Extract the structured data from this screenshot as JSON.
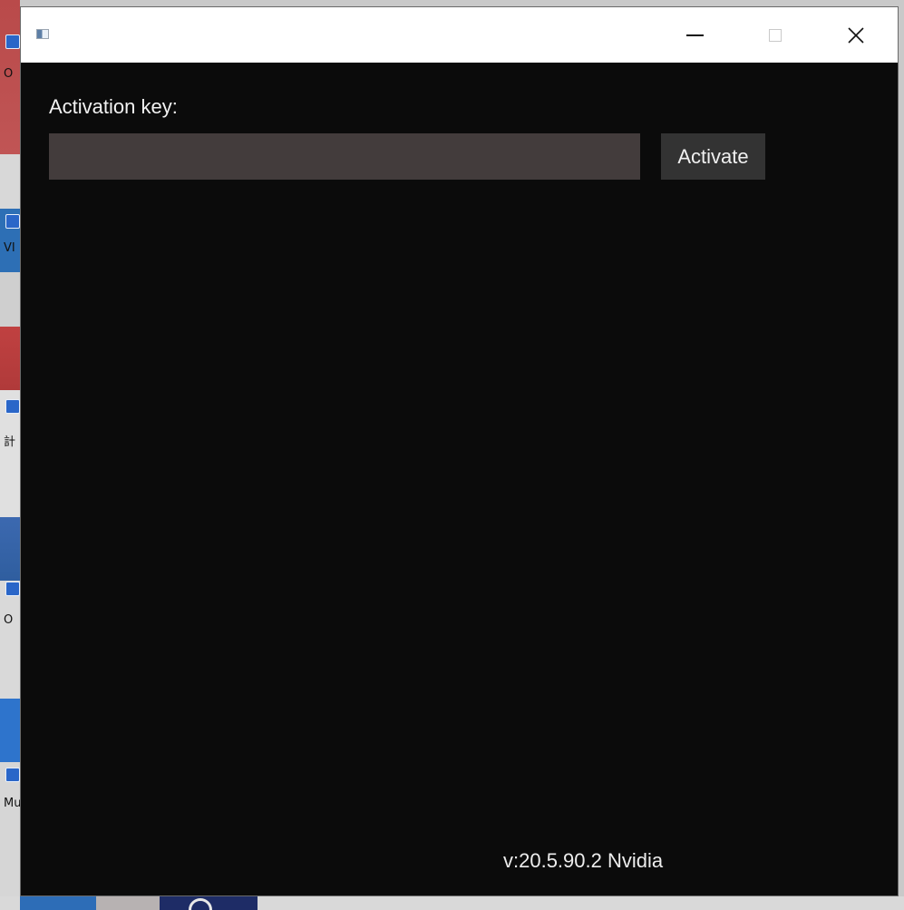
{
  "desktop": {
    "labels": [
      "O",
      "VI",
      "計",
      "O",
      "Mu"
    ]
  },
  "window": {
    "title": "",
    "controls": {
      "minimize_icon": "minimize-icon",
      "maximize_icon": "maximize-icon",
      "close_icon": "close-icon",
      "close_glyph": "✕"
    }
  },
  "form": {
    "key_label": "Activation key:",
    "key_value": "",
    "key_placeholder": "",
    "activate_label": "Activate"
  },
  "footer": {
    "version": "v:20.5.90.2 Nvidia"
  },
  "colors": {
    "window_bg": "#0b0b0b",
    "input_bg": "#433c3c",
    "button_bg": "#333333",
    "titlebar_bg": "#ffffff"
  }
}
